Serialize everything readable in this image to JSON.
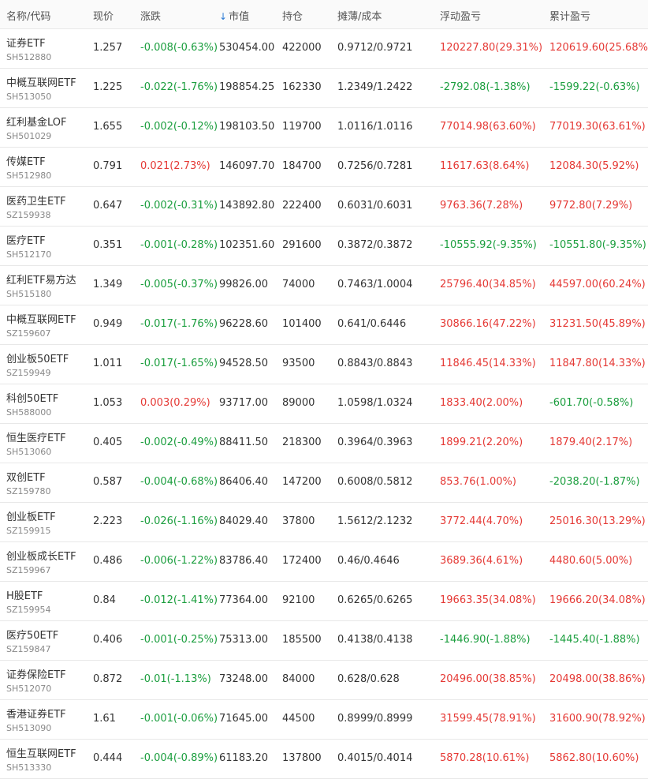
{
  "colors": {
    "up": "#e53935",
    "down": "#1b9e3e",
    "accent": "#2a7ad5"
  },
  "header": {
    "name": "名称/代码",
    "price": "现价",
    "change": "涨跌",
    "sort_icon": "down-arrow-icon",
    "market_value": "市值",
    "holding": "持仓",
    "cost": "摊薄/成本",
    "float_pnl": "浮动盈亏",
    "cum_pnl": "累计盈亏"
  },
  "rows": [
    {
      "name": "证券ETF",
      "code": "SH512880",
      "price": "1.257",
      "change": "-0.008(-0.63%)",
      "change_dir": "down",
      "mv": "530454.00",
      "hold": "422000",
      "cost": "0.9712/0.9721",
      "float": "120227.80(29.31%)",
      "float_dir": "up",
      "cum": "120619.60(25.68%)",
      "cum_dir": "up"
    },
    {
      "name": "中概互联网ETF",
      "code": "SH513050",
      "price": "1.225",
      "change": "-0.022(-1.76%)",
      "change_dir": "down",
      "mv": "198854.25",
      "hold": "162330",
      "cost": "1.2349/1.2422",
      "float": "-2792.08(-1.38%)",
      "float_dir": "down",
      "cum": "-1599.22(-0.63%)",
      "cum_dir": "down"
    },
    {
      "name": "红利基金LOF",
      "code": "SH501029",
      "price": "1.655",
      "change": "-0.002(-0.12%)",
      "change_dir": "down",
      "mv": "198103.50",
      "hold": "119700",
      "cost": "1.0116/1.0116",
      "float": "77014.98(63.60%)",
      "float_dir": "up",
      "cum": "77019.30(63.61%)",
      "cum_dir": "up"
    },
    {
      "name": "传媒ETF",
      "code": "SH512980",
      "price": "0.791",
      "change": "0.021(2.73%)",
      "change_dir": "up",
      "mv": "146097.70",
      "hold": "184700",
      "cost": "0.7256/0.7281",
      "float": "11617.63(8.64%)",
      "float_dir": "up",
      "cum": "12084.30(5.92%)",
      "cum_dir": "up"
    },
    {
      "name": "医药卫生ETF",
      "code": "SZ159938",
      "price": "0.647",
      "change": "-0.002(-0.31%)",
      "change_dir": "down",
      "mv": "143892.80",
      "hold": "222400",
      "cost": "0.6031/0.6031",
      "float": "9763.36(7.28%)",
      "float_dir": "up",
      "cum": "9772.80(7.29%)",
      "cum_dir": "up"
    },
    {
      "name": "医疗ETF",
      "code": "SH512170",
      "price": "0.351",
      "change": "-0.001(-0.28%)",
      "change_dir": "down",
      "mv": "102351.60",
      "hold": "291600",
      "cost": "0.3872/0.3872",
      "float": "-10555.92(-9.35%)",
      "float_dir": "down",
      "cum": "-10551.80(-9.35%)",
      "cum_dir": "down"
    },
    {
      "name": "红利ETF易方达",
      "code": "SH515180",
      "price": "1.349",
      "change": "-0.005(-0.37%)",
      "change_dir": "down",
      "mv": "99826.00",
      "hold": "74000",
      "cost": "0.7463/1.0004",
      "float": "25796.40(34.85%)",
      "float_dir": "up",
      "cum": "44597.00(60.24%)",
      "cum_dir": "up"
    },
    {
      "name": "中概互联网ETF",
      "code": "SZ159607",
      "price": "0.949",
      "change": "-0.017(-1.76%)",
      "change_dir": "down",
      "mv": "96228.60",
      "hold": "101400",
      "cost": "0.641/0.6446",
      "float": "30866.16(47.22%)",
      "float_dir": "up",
      "cum": "31231.50(45.89%)",
      "cum_dir": "up"
    },
    {
      "name": "创业板50ETF",
      "code": "SZ159949",
      "price": "1.011",
      "change": "-0.017(-1.65%)",
      "change_dir": "down",
      "mv": "94528.50",
      "hold": "93500",
      "cost": "0.8843/0.8843",
      "float": "11846.45(14.33%)",
      "float_dir": "up",
      "cum": "11847.80(14.33%)",
      "cum_dir": "up"
    },
    {
      "name": "科创50ETF",
      "code": "SH588000",
      "price": "1.053",
      "change": "0.003(0.29%)",
      "change_dir": "up",
      "mv": "93717.00",
      "hold": "89000",
      "cost": "1.0598/1.0324",
      "float": "1833.40(2.00%)",
      "float_dir": "up",
      "cum": "-601.70(-0.58%)",
      "cum_dir": "down"
    },
    {
      "name": "恒生医疗ETF",
      "code": "SH513060",
      "price": "0.405",
      "change": "-0.002(-0.49%)",
      "change_dir": "down",
      "mv": "88411.50",
      "hold": "218300",
      "cost": "0.3964/0.3963",
      "float": "1899.21(2.20%)",
      "float_dir": "up",
      "cum": "1879.40(2.17%)",
      "cum_dir": "up"
    },
    {
      "name": "双创ETF",
      "code": "SZ159780",
      "price": "0.587",
      "change": "-0.004(-0.68%)",
      "change_dir": "down",
      "mv": "86406.40",
      "hold": "147200",
      "cost": "0.6008/0.5812",
      "float": "853.76(1.00%)",
      "float_dir": "up",
      "cum": "-2038.20(-1.87%)",
      "cum_dir": "down"
    },
    {
      "name": "创业板ETF",
      "code": "SZ159915",
      "price": "2.223",
      "change": "-0.026(-1.16%)",
      "change_dir": "down",
      "mv": "84029.40",
      "hold": "37800",
      "cost": "1.5612/2.1232",
      "float": "3772.44(4.70%)",
      "float_dir": "up",
      "cum": "25016.30(13.29%)",
      "cum_dir": "up"
    },
    {
      "name": "创业板成长ETF",
      "code": "SZ159967",
      "price": "0.486",
      "change": "-0.006(-1.22%)",
      "change_dir": "down",
      "mv": "83786.40",
      "hold": "172400",
      "cost": "0.46/0.4646",
      "float": "3689.36(4.61%)",
      "float_dir": "up",
      "cum": "4480.60(5.00%)",
      "cum_dir": "up"
    },
    {
      "name": "H股ETF",
      "code": "SZ159954",
      "price": "0.84",
      "change": "-0.012(-1.41%)",
      "change_dir": "down",
      "mv": "77364.00",
      "hold": "92100",
      "cost": "0.6265/0.6265",
      "float": "19663.35(34.08%)",
      "float_dir": "up",
      "cum": "19666.20(34.08%)",
      "cum_dir": "up"
    },
    {
      "name": "医疗50ETF",
      "code": "SZ159847",
      "price": "0.406",
      "change": "-0.001(-0.25%)",
      "change_dir": "down",
      "mv": "75313.00",
      "hold": "185500",
      "cost": "0.4138/0.4138",
      "float": "-1446.90(-1.88%)",
      "float_dir": "down",
      "cum": "-1445.40(-1.88%)",
      "cum_dir": "down"
    },
    {
      "name": "证券保险ETF",
      "code": "SH512070",
      "price": "0.872",
      "change": "-0.01(-1.13%)",
      "change_dir": "down",
      "mv": "73248.00",
      "hold": "84000",
      "cost": "0.628/0.628",
      "float": "20496.00(38.85%)",
      "float_dir": "up",
      "cum": "20498.00(38.86%)",
      "cum_dir": "up"
    },
    {
      "name": "香港证券ETF",
      "code": "SH513090",
      "price": "1.61",
      "change": "-0.001(-0.06%)",
      "change_dir": "down",
      "mv": "71645.00",
      "hold": "44500",
      "cost": "0.8999/0.8999",
      "float": "31599.45(78.91%)",
      "float_dir": "up",
      "cum": "31600.90(78.92%)",
      "cum_dir": "up"
    },
    {
      "name": "恒生互联网ETF",
      "code": "SH513330",
      "price": "0.444",
      "change": "-0.004(-0.89%)",
      "change_dir": "down",
      "mv": "61183.20",
      "hold": "137800",
      "cost": "0.4015/0.4014",
      "float": "5870.28(10.61%)",
      "float_dir": "up",
      "cum": "5862.80(10.60%)",
      "cum_dir": "up"
    }
  ]
}
